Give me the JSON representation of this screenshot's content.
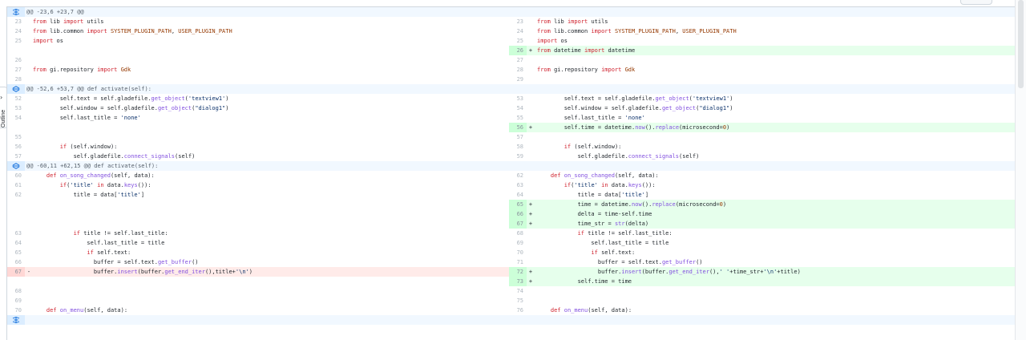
{
  "sidebar": {
    "outline_label": "Outline"
  },
  "colors": {
    "added_line_bg": "#e6ffec",
    "added_gutter_bg": "#ccffd8",
    "deleted_line_bg": "#ffebe9",
    "deleted_gutter_bg": "#ffd7d5",
    "hunk_bg": "#f1f8ff",
    "keyword": "#cf222e",
    "string": "#0a3069",
    "function": "#8250df",
    "constant": "#953800"
  },
  "rows": [
    {
      "type": "hunk",
      "text": "@@ -23,6 +23,7 @@",
      "icon": "unfold-icon"
    },
    {
      "type": "line",
      "left": {
        "n": "23",
        "cls": "ctx",
        "tokens": [
          [
            "kw",
            "from"
          ],
          [
            "p",
            " lib "
          ],
          [
            "kw",
            "import"
          ],
          [
            "p",
            " utils"
          ]
        ]
      },
      "right": {
        "n": "23",
        "cls": "ctx",
        "tokens": [
          [
            "kw",
            "from"
          ],
          [
            "p",
            " lib "
          ],
          [
            "kw",
            "import"
          ],
          [
            "p",
            " utils"
          ]
        ]
      }
    },
    {
      "type": "line",
      "left": {
        "n": "24",
        "cls": "ctx",
        "tokens": [
          [
            "kw",
            "from"
          ],
          [
            "p",
            " lib.common "
          ],
          [
            "kw",
            "import"
          ],
          [
            "p",
            " "
          ],
          [
            "name",
            "SYSTEM_PLUGIN_PATH"
          ],
          [
            "p",
            ", "
          ],
          [
            "name",
            "USER_PLUGIN_PATH"
          ]
        ]
      },
      "right": {
        "n": "24",
        "cls": "ctx",
        "tokens": [
          [
            "kw",
            "from"
          ],
          [
            "p",
            " lib.common "
          ],
          [
            "kw",
            "import"
          ],
          [
            "p",
            " "
          ],
          [
            "name",
            "SYSTEM_PLUGIN_PATH"
          ],
          [
            "p",
            ", "
          ],
          [
            "name",
            "USER_PLUGIN_PATH"
          ]
        ]
      }
    },
    {
      "type": "line",
      "left": {
        "n": "25",
        "cls": "ctx",
        "tokens": [
          [
            "kw",
            "import"
          ],
          [
            "p",
            " os"
          ]
        ]
      },
      "right": {
        "n": "25",
        "cls": "ctx",
        "tokens": [
          [
            "kw",
            "import"
          ],
          [
            "p",
            " os"
          ]
        ]
      }
    },
    {
      "type": "line",
      "left": {
        "n": "",
        "cls": "empty",
        "tokens": []
      },
      "right": {
        "n": "26",
        "cls": "add",
        "marker": "+",
        "tokens": [
          [
            "kw",
            "from"
          ],
          [
            "p",
            " datetime "
          ],
          [
            "kw",
            "import"
          ],
          [
            "p",
            " datetime"
          ]
        ]
      }
    },
    {
      "type": "line",
      "left": {
        "n": "26",
        "cls": "ctx",
        "tokens": []
      },
      "right": {
        "n": "27",
        "cls": "ctx",
        "tokens": []
      }
    },
    {
      "type": "line",
      "left": {
        "n": "27",
        "cls": "ctx",
        "tokens": [
          [
            "kw",
            "from"
          ],
          [
            "p",
            " gi.repository "
          ],
          [
            "kw",
            "import"
          ],
          [
            "p",
            " "
          ],
          [
            "name",
            "Gdk"
          ]
        ]
      },
      "right": {
        "n": "28",
        "cls": "ctx",
        "tokens": [
          [
            "kw",
            "from"
          ],
          [
            "p",
            " gi.repository "
          ],
          [
            "kw",
            "import"
          ],
          [
            "p",
            " "
          ],
          [
            "name",
            "Gdk"
          ]
        ]
      }
    },
    {
      "type": "line",
      "left": {
        "n": "28",
        "cls": "ctx",
        "tokens": []
      },
      "right": {
        "n": "29",
        "cls": "ctx",
        "tokens": []
      }
    },
    {
      "type": "hunk",
      "text": "@@ -52,6 +53,7 @@ def activate(self):",
      "icon": "expand-both-icon"
    },
    {
      "type": "line",
      "left": {
        "n": "52",
        "cls": "ctx",
        "tokens": [
          [
            "p",
            "        self.text = self.gladefile."
          ],
          [
            "fn",
            "get_object"
          ],
          [
            "p",
            "("
          ],
          [
            "str",
            "'textview1'"
          ],
          [
            "p",
            ")"
          ]
        ]
      },
      "right": {
        "n": "53",
        "cls": "ctx",
        "tokens": [
          [
            "p",
            "        self.text = self.gladefile."
          ],
          [
            "fn",
            "get_object"
          ],
          [
            "p",
            "("
          ],
          [
            "str",
            "'textview1'"
          ],
          [
            "p",
            ")"
          ]
        ]
      }
    },
    {
      "type": "line",
      "left": {
        "n": "53",
        "cls": "ctx",
        "tokens": [
          [
            "p",
            "        self.window = self.gladefile."
          ],
          [
            "fn",
            "get_object"
          ],
          [
            "p",
            "("
          ],
          [
            "str",
            "\"dialog1\""
          ],
          [
            "p",
            ")"
          ]
        ]
      },
      "right": {
        "n": "54",
        "cls": "ctx",
        "tokens": [
          [
            "p",
            "        self.window = self.gladefile."
          ],
          [
            "fn",
            "get_object"
          ],
          [
            "p",
            "("
          ],
          [
            "str",
            "\"dialog1\""
          ],
          [
            "p",
            ")"
          ]
        ]
      }
    },
    {
      "type": "line",
      "left": {
        "n": "54",
        "cls": "ctx",
        "tokens": [
          [
            "p",
            "        self.last_title = "
          ],
          [
            "str",
            "'none'"
          ]
        ]
      },
      "right": {
        "n": "55",
        "cls": "ctx",
        "tokens": [
          [
            "p",
            "        self.last_title = "
          ],
          [
            "str",
            "'none'"
          ]
        ]
      }
    },
    {
      "type": "line",
      "left": {
        "n": "",
        "cls": "empty",
        "tokens": []
      },
      "right": {
        "n": "56",
        "cls": "add",
        "marker": "+",
        "tokens": [
          [
            "p",
            "        self.time = datetime."
          ],
          [
            "fn",
            "now"
          ],
          [
            "p",
            "()."
          ],
          [
            "fn",
            "replace"
          ],
          [
            "p",
            "(microsecond="
          ],
          [
            "name",
            "0"
          ],
          [
            "p",
            ")"
          ]
        ]
      }
    },
    {
      "type": "line",
      "left": {
        "n": "55",
        "cls": "ctx",
        "tokens": []
      },
      "right": {
        "n": "57",
        "cls": "ctx",
        "tokens": []
      }
    },
    {
      "type": "line",
      "left": {
        "n": "56",
        "cls": "ctx",
        "tokens": [
          [
            "p",
            "        "
          ],
          [
            "kw",
            "if"
          ],
          [
            "p",
            " (self.window):"
          ]
        ]
      },
      "right": {
        "n": "58",
        "cls": "ctx",
        "tokens": [
          [
            "p",
            "        "
          ],
          [
            "kw",
            "if"
          ],
          [
            "p",
            " (self.window):"
          ]
        ]
      }
    },
    {
      "type": "line",
      "left": {
        "n": "57",
        "cls": "ctx",
        "tokens": [
          [
            "p",
            "            self.gladefile."
          ],
          [
            "fn",
            "connect_signals"
          ],
          [
            "p",
            "(self)"
          ]
        ]
      },
      "right": {
        "n": "59",
        "cls": "ctx",
        "tokens": [
          [
            "p",
            "            self.gladefile."
          ],
          [
            "fn",
            "connect_signals"
          ],
          [
            "p",
            "(self)"
          ]
        ]
      }
    },
    {
      "type": "hunk",
      "text": "@@ -60,11 +62,15 @@ def activate(self):",
      "icon": "expand-both-icon"
    },
    {
      "type": "line",
      "left": {
        "n": "60",
        "cls": "ctx",
        "tokens": [
          [
            "p",
            "    "
          ],
          [
            "kw",
            "def"
          ],
          [
            "p",
            " "
          ],
          [
            "fn",
            "on_song_changed"
          ],
          [
            "p",
            "(self, data):"
          ]
        ]
      },
      "right": {
        "n": "62",
        "cls": "ctx",
        "tokens": [
          [
            "p",
            "    "
          ],
          [
            "kw",
            "def"
          ],
          [
            "p",
            " "
          ],
          [
            "fn",
            "on_song_changed"
          ],
          [
            "p",
            "(self, data):"
          ]
        ]
      }
    },
    {
      "type": "line",
      "left": {
        "n": "61",
        "cls": "ctx",
        "tokens": [
          [
            "p",
            "        "
          ],
          [
            "kw",
            "if"
          ],
          [
            "p",
            "("
          ],
          [
            "str",
            "'title'"
          ],
          [
            "p",
            " "
          ],
          [
            "kw",
            "in"
          ],
          [
            "p",
            " data."
          ],
          [
            "fn",
            "keys"
          ],
          [
            "p",
            "()):"
          ]
        ]
      },
      "right": {
        "n": "63",
        "cls": "ctx",
        "tokens": [
          [
            "p",
            "        "
          ],
          [
            "kw",
            "if"
          ],
          [
            "p",
            "("
          ],
          [
            "str",
            "'title'"
          ],
          [
            "p",
            " "
          ],
          [
            "kw",
            "in"
          ],
          [
            "p",
            " data."
          ],
          [
            "fn",
            "keys"
          ],
          [
            "p",
            "()):"
          ]
        ]
      }
    },
    {
      "type": "line",
      "left": {
        "n": "62",
        "cls": "ctx",
        "tokens": [
          [
            "p",
            "            title = data["
          ],
          [
            "str",
            "'title'"
          ],
          [
            "p",
            "]"
          ]
        ]
      },
      "right": {
        "n": "64",
        "cls": "ctx",
        "tokens": [
          [
            "p",
            "            title = data["
          ],
          [
            "str",
            "'title'"
          ],
          [
            "p",
            "]"
          ]
        ]
      }
    },
    {
      "type": "line",
      "left": {
        "n": "",
        "cls": "empty",
        "tokens": []
      },
      "right": {
        "n": "65",
        "cls": "add",
        "marker": "+",
        "tokens": [
          [
            "p",
            "            time = datetime."
          ],
          [
            "fn",
            "now"
          ],
          [
            "p",
            "()."
          ],
          [
            "fn",
            "replace"
          ],
          [
            "p",
            "(microsecond="
          ],
          [
            "name",
            "0"
          ],
          [
            "p",
            ")"
          ]
        ]
      }
    },
    {
      "type": "line",
      "left": {
        "n": "",
        "cls": "empty",
        "tokens": []
      },
      "right": {
        "n": "66",
        "cls": "add",
        "marker": "+",
        "tokens": [
          [
            "p",
            "            delta = time-self.time"
          ]
        ]
      }
    },
    {
      "type": "line",
      "left": {
        "n": "",
        "cls": "empty",
        "tokens": []
      },
      "right": {
        "n": "67",
        "cls": "add",
        "marker": "+",
        "tokens": [
          [
            "p",
            "            time_str = "
          ],
          [
            "fn",
            "str"
          ],
          [
            "p",
            "(delta)"
          ]
        ]
      }
    },
    {
      "type": "line",
      "left": {
        "n": "63",
        "cls": "ctx",
        "tokens": [
          [
            "p",
            "            "
          ],
          [
            "kw",
            "if"
          ],
          [
            "p",
            " title != self.last_title:"
          ]
        ]
      },
      "right": {
        "n": "68",
        "cls": "ctx",
        "tokens": [
          [
            "p",
            "            "
          ],
          [
            "kw",
            "if"
          ],
          [
            "p",
            " title != self.last_title:"
          ]
        ]
      }
    },
    {
      "type": "line",
      "left": {
        "n": "64",
        "cls": "ctx",
        "tokens": [
          [
            "p",
            "                self.last_title = title"
          ]
        ]
      },
      "right": {
        "n": "69",
        "cls": "ctx",
        "tokens": [
          [
            "p",
            "                self.last_title = title"
          ]
        ]
      }
    },
    {
      "type": "line",
      "left": {
        "n": "65",
        "cls": "ctx",
        "tokens": [
          [
            "p",
            "                "
          ],
          [
            "kw",
            "if"
          ],
          [
            "p",
            " self.text:"
          ]
        ]
      },
      "right": {
        "n": "70",
        "cls": "ctx",
        "tokens": [
          [
            "p",
            "                "
          ],
          [
            "kw",
            "if"
          ],
          [
            "p",
            " self.text:"
          ]
        ]
      }
    },
    {
      "type": "line",
      "left": {
        "n": "66",
        "cls": "ctx",
        "tokens": [
          [
            "p",
            "                  buffer = self.text."
          ],
          [
            "fn",
            "get_buffer"
          ],
          [
            "p",
            "()"
          ]
        ]
      },
      "right": {
        "n": "71",
        "cls": "ctx",
        "tokens": [
          [
            "p",
            "                  buffer = self.text."
          ],
          [
            "fn",
            "get_buffer"
          ],
          [
            "p",
            "()"
          ]
        ]
      }
    },
    {
      "type": "line",
      "left": {
        "n": "67",
        "cls": "del",
        "marker": "-",
        "tokens": [
          [
            "p",
            "                  buffer."
          ],
          [
            "fn",
            "insert"
          ],
          [
            "p",
            "(buffer."
          ],
          [
            "fn",
            "get_end_iter"
          ],
          [
            "p",
            "(),title+"
          ],
          [
            "str",
            "'\\n'"
          ],
          [
            "p",
            ")"
          ]
        ]
      },
      "right": {
        "n": "72",
        "cls": "add",
        "marker": "+",
        "tokens": [
          [
            "p",
            "                  buffer."
          ],
          [
            "fn",
            "insert"
          ],
          [
            "p",
            "(buffer."
          ],
          [
            "fn",
            "get_end_iter"
          ],
          [
            "p",
            "(),"
          ],
          [
            "str",
            "' '"
          ],
          [
            "p",
            "+time_str+"
          ],
          [
            "str",
            "'\\n'"
          ],
          [
            "p",
            "+title)"
          ]
        ]
      }
    },
    {
      "type": "line",
      "left": {
        "n": "",
        "cls": "empty",
        "tokens": []
      },
      "right": {
        "n": "73",
        "cls": "add",
        "marker": "+",
        "tokens": [
          [
            "p",
            "            self.time = time"
          ]
        ]
      }
    },
    {
      "type": "line",
      "left": {
        "n": "68",
        "cls": "ctx",
        "tokens": []
      },
      "right": {
        "n": "74",
        "cls": "ctx",
        "tokens": []
      }
    },
    {
      "type": "line",
      "left": {
        "n": "69",
        "cls": "ctx",
        "tokens": []
      },
      "right": {
        "n": "75",
        "cls": "ctx",
        "tokens": []
      }
    },
    {
      "type": "line",
      "left": {
        "n": "70",
        "cls": "ctx",
        "tokens": [
          [
            "p",
            "    "
          ],
          [
            "kw",
            "def"
          ],
          [
            "p",
            " "
          ],
          [
            "fn",
            "on_menu"
          ],
          [
            "p",
            "(self, data):"
          ]
        ]
      },
      "right": {
        "n": "76",
        "cls": "ctx",
        "tokens": [
          [
            "p",
            "    "
          ],
          [
            "kw",
            "def"
          ],
          [
            "p",
            " "
          ],
          [
            "fn",
            "on_menu"
          ],
          [
            "p",
            "(self, data):"
          ]
        ]
      }
    },
    {
      "type": "hunk",
      "text": "",
      "icon": "unfold-icon"
    }
  ]
}
